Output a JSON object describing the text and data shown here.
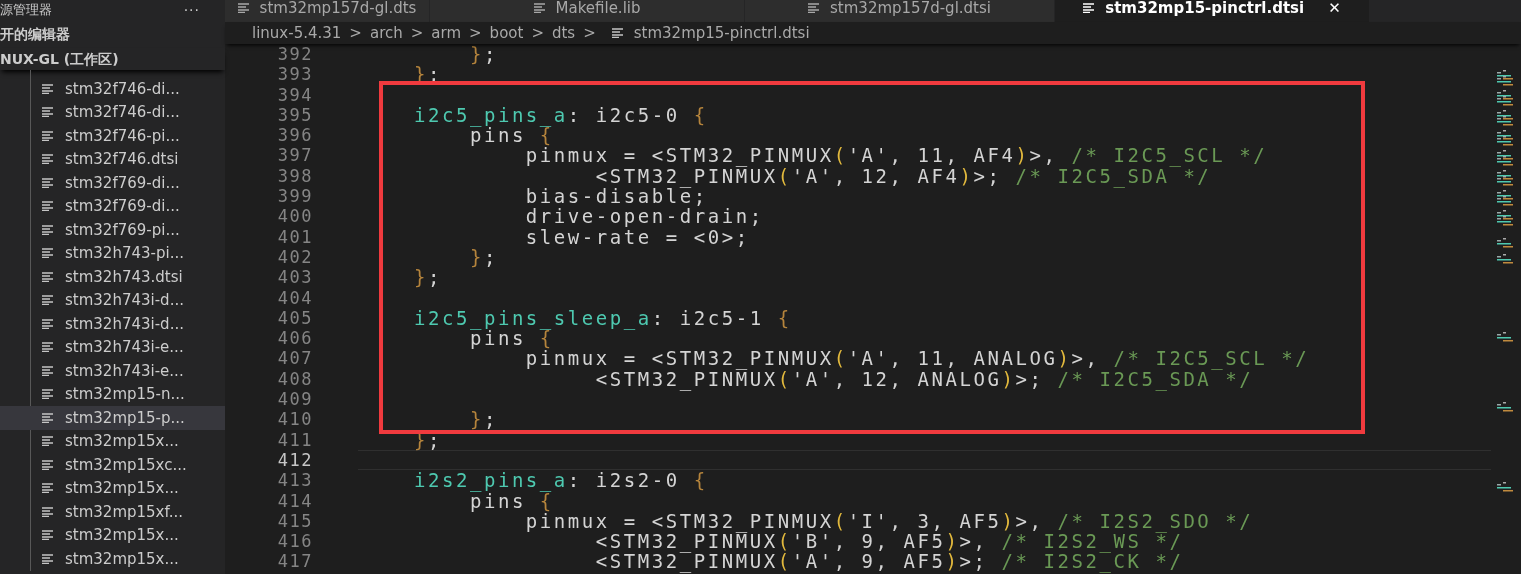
{
  "sidebar": {
    "title": "源管理器",
    "more": "···",
    "open_editors": "开的编辑器",
    "workspace": "NUX-GL (工作区)",
    "files": [
      {
        "name": "stm32f746-di...",
        "selected": false
      },
      {
        "name": "stm32f746-di...",
        "selected": false
      },
      {
        "name": "stm32f746-pi...",
        "selected": false
      },
      {
        "name": "stm32f746.dtsi",
        "selected": false
      },
      {
        "name": "stm32f769-di...",
        "selected": false
      },
      {
        "name": "stm32f769-di...",
        "selected": false
      },
      {
        "name": "stm32f769-pi...",
        "selected": false
      },
      {
        "name": "stm32h743-pi...",
        "selected": false
      },
      {
        "name": "stm32h743.dtsi",
        "selected": false
      },
      {
        "name": "stm32h743i-d...",
        "selected": false
      },
      {
        "name": "stm32h743i-d...",
        "selected": false
      },
      {
        "name": "stm32h743i-e...",
        "selected": false
      },
      {
        "name": "stm32h743i-e...",
        "selected": false
      },
      {
        "name": "stm32mp15-n...",
        "selected": false
      },
      {
        "name": "stm32mp15-p...",
        "selected": true
      },
      {
        "name": "stm32mp15x...",
        "selected": false
      },
      {
        "name": "stm32mp15xc...",
        "selected": false
      },
      {
        "name": "stm32mp15x...",
        "selected": false
      },
      {
        "name": "stm32mp15xf...",
        "selected": false
      },
      {
        "name": "stm32mp15x...",
        "selected": false
      },
      {
        "name": "stm32mp15x...",
        "selected": false
      }
    ]
  },
  "tabs": [
    {
      "label": "stm32mp157d-gl.dts",
      "selected": false
    },
    {
      "label": "Makefile.lib",
      "selected": false
    },
    {
      "label": "stm32mp157d-gl.dtsi",
      "selected": false
    },
    {
      "label": "stm32mp15-pinctrl.dtsi",
      "selected": true,
      "close": "✕"
    }
  ],
  "breadcrumb": {
    "separator": ">",
    "folders": [
      "linux-5.4.31",
      "arch",
      "arm",
      "boot",
      "dts"
    ],
    "file": "stm32mp15-pinctrl.dtsi"
  },
  "editor": {
    "lines": [
      {
        "number": "392",
        "current": false,
        "boxed": false,
        "segments": [
          {
            "kind": "brace",
            "text": "        }"
          },
          {
            "kind": "plain",
            "text": ";"
          }
        ]
      },
      {
        "number": "393",
        "current": false,
        "boxed": false,
        "segments": [
          {
            "kind": "brace",
            "text": "    }"
          },
          {
            "kind": "plain",
            "text": ";"
          }
        ]
      },
      {
        "number": "394",
        "current": false,
        "boxed": true
      },
      {
        "number": "395",
        "current": false,
        "boxed": true,
        "segments": [
          {
            "kind": "label",
            "text": "    i2c5_pins_a"
          },
          {
            "kind": "plain",
            "text": ": i2c5-0 "
          },
          {
            "kind": "brace",
            "text": "{"
          }
        ]
      },
      {
        "number": "396",
        "current": false,
        "boxed": true,
        "segments": [
          {
            "kind": "plain",
            "text": "        pins "
          },
          {
            "kind": "brace",
            "text": "{"
          }
        ]
      },
      {
        "number": "397",
        "current": false,
        "boxed": true,
        "segments": [
          {
            "kind": "plain",
            "text": "            pinmux = <STM32_PINMUX"
          },
          {
            "kind": "paren",
            "text": "("
          },
          {
            "kind": "plain",
            "text": "'A', 11, AF4"
          },
          {
            "kind": "paren",
            "text": ")"
          },
          {
            "kind": "plain",
            "text": ">, "
          },
          {
            "kind": "comment",
            "text": "/* I2C5_SCL */"
          }
        ]
      },
      {
        "number": "398",
        "current": false,
        "boxed": true,
        "segments": [
          {
            "kind": "plain",
            "text": "                 <STM32_PINMUX"
          },
          {
            "kind": "paren",
            "text": "("
          },
          {
            "kind": "plain",
            "text": "'A', 12, AF4"
          },
          {
            "kind": "paren",
            "text": ")"
          },
          {
            "kind": "plain",
            "text": ">; "
          },
          {
            "kind": "comment",
            "text": "/* I2C5_SDA */"
          }
        ]
      },
      {
        "number": "399",
        "current": false,
        "boxed": true,
        "segments": [
          {
            "kind": "plain",
            "text": "            bias-disable;"
          }
        ]
      },
      {
        "number": "400",
        "current": false,
        "boxed": true,
        "segments": [
          {
            "kind": "plain",
            "text": "            drive-open-drain;"
          }
        ]
      },
      {
        "number": "401",
        "current": false,
        "boxed": true,
        "segments": [
          {
            "kind": "plain",
            "text": "            slew-rate = <0>;"
          }
        ]
      },
      {
        "number": "402",
        "current": false,
        "boxed": true,
        "segments": [
          {
            "kind": "brace",
            "text": "        }"
          },
          {
            "kind": "plain",
            "text": ";"
          }
        ]
      },
      {
        "number": "403",
        "current": false,
        "boxed": true,
        "segments": [
          {
            "kind": "brace",
            "text": "    }"
          },
          {
            "kind": "plain",
            "text": ";"
          }
        ]
      },
      {
        "number": "404",
        "current": false,
        "boxed": true
      },
      {
        "number": "405",
        "current": false,
        "boxed": true,
        "segments": [
          {
            "kind": "label",
            "text": "    i2c5_pins_sleep_a"
          },
          {
            "kind": "plain",
            "text": ": i2c5-1 "
          },
          {
            "kind": "brace",
            "text": "{"
          }
        ]
      },
      {
        "number": "406",
        "current": false,
        "boxed": true,
        "segments": [
          {
            "kind": "plain",
            "text": "        pins "
          },
          {
            "kind": "brace",
            "text": "{"
          }
        ]
      },
      {
        "number": "407",
        "current": false,
        "boxed": true,
        "segments": [
          {
            "kind": "plain",
            "text": "            pinmux = <STM32_PINMUX"
          },
          {
            "kind": "paren",
            "text": "("
          },
          {
            "kind": "plain",
            "text": "'A', 11, ANALOG"
          },
          {
            "kind": "paren",
            "text": ")"
          },
          {
            "kind": "plain",
            "text": ">, "
          },
          {
            "kind": "comment",
            "text": "/* I2C5_SCL */"
          }
        ]
      },
      {
        "number": "408",
        "current": false,
        "boxed": true,
        "segments": [
          {
            "kind": "plain",
            "text": "                 <STM32_PINMUX"
          },
          {
            "kind": "paren",
            "text": "("
          },
          {
            "kind": "plain",
            "text": "'A', 12, ANALOG"
          },
          {
            "kind": "paren",
            "text": ")"
          },
          {
            "kind": "plain",
            "text": ">; "
          },
          {
            "kind": "comment",
            "text": "/* I2C5_SDA */"
          }
        ]
      },
      {
        "number": "409",
        "current": false,
        "boxed": true
      },
      {
        "number": "410",
        "current": false,
        "boxed": true,
        "segments": [
          {
            "kind": "brace",
            "text": "        }"
          },
          {
            "kind": "plain",
            "text": ";"
          }
        ]
      },
      {
        "number": "411",
        "current": false,
        "boxed": false,
        "segments": [
          {
            "kind": "brace",
            "text": "    }"
          },
          {
            "kind": "plain",
            "text": ";"
          }
        ]
      },
      {
        "number": "412",
        "current": true,
        "boxed": false
      },
      {
        "number": "413",
        "current": false,
        "boxed": false,
        "segments": [
          {
            "kind": "label",
            "text": "    i2s2_pins_a"
          },
          {
            "kind": "plain",
            "text": ": i2s2-0 "
          },
          {
            "kind": "brace",
            "text": "{"
          }
        ]
      },
      {
        "number": "414",
        "current": false,
        "boxed": false,
        "segments": [
          {
            "kind": "plain",
            "text": "        pins "
          },
          {
            "kind": "brace",
            "text": "{"
          }
        ]
      },
      {
        "number": "415",
        "current": false,
        "boxed": false,
        "segments": [
          {
            "kind": "plain",
            "text": "            pinmux = <STM32_PINMUX"
          },
          {
            "kind": "paren",
            "text": "("
          },
          {
            "kind": "plain",
            "text": "'I', 3, AF5"
          },
          {
            "kind": "paren",
            "text": ")"
          },
          {
            "kind": "plain",
            "text": ">, "
          },
          {
            "kind": "comment",
            "text": "/* I2S2_SDO */"
          }
        ]
      },
      {
        "number": "416",
        "current": false,
        "boxed": false,
        "segments": [
          {
            "kind": "plain",
            "text": "                 <STM32_PINMUX"
          },
          {
            "kind": "paren",
            "text": "("
          },
          {
            "kind": "plain",
            "text": "'B', 9, AF5"
          },
          {
            "kind": "paren",
            "text": ")"
          },
          {
            "kind": "plain",
            "text": ">, "
          },
          {
            "kind": "comment",
            "text": "/* I2S2_WS */"
          }
        ]
      },
      {
        "number": "417",
        "current": false,
        "boxed": false,
        "segments": [
          {
            "kind": "plain",
            "text": "                 <STM32_PINMUX"
          },
          {
            "kind": "paren",
            "text": "("
          },
          {
            "kind": "plain",
            "text": "'A', 9, AF5"
          },
          {
            "kind": "paren",
            "text": ")"
          },
          {
            "kind": "plain",
            "text": ">; "
          },
          {
            "kind": "comment",
            "text": "/* I2S2_CK */"
          }
        ]
      }
    ]
  }
}
